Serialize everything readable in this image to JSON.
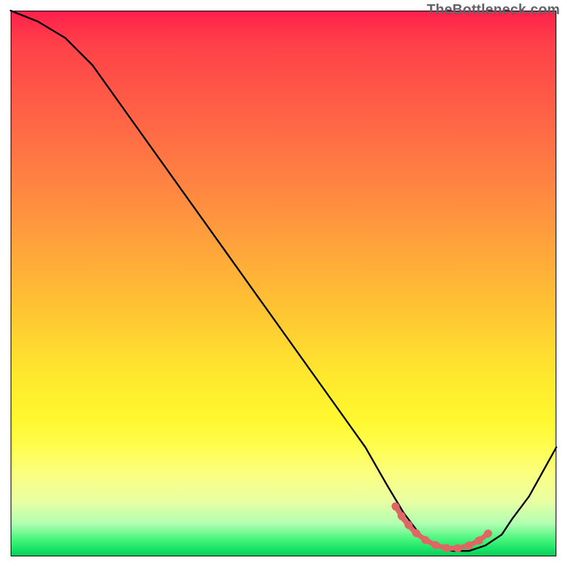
{
  "branding": "TheBottleneck.com",
  "colors": {
    "curve": "#000000",
    "highlight": "#e06666",
    "border": "#000000"
  },
  "chart_data": {
    "type": "line",
    "title": "",
    "xlabel": "",
    "ylabel": "",
    "xlim": [
      0,
      100
    ],
    "ylim": [
      0,
      100
    ],
    "grid": false,
    "note": "Axes are implied (no tick labels in image); values estimated from pixel positions within the 770×770 gradient plot area.",
    "series": [
      {
        "name": "curve",
        "x": [
          0,
          5,
          10,
          15,
          20,
          25,
          30,
          35,
          40,
          45,
          50,
          55,
          60,
          65,
          69,
          72,
          75,
          78,
          81,
          84,
          87,
          90,
          92,
          95,
          100
        ],
        "y": [
          100,
          98,
          95,
          90,
          83,
          76,
          69,
          62,
          55,
          48,
          41,
          34,
          27,
          20,
          13,
          8,
          4,
          2,
          1,
          1,
          2,
          4,
          7,
          11,
          20
        ]
      },
      {
        "name": "highlight-band",
        "x": [
          70.5,
          72,
          74,
          76,
          78,
          80,
          82,
          84,
          86,
          87.5
        ],
        "y": [
          9.2,
          6.8,
          4.5,
          3.0,
          2.0,
          1.5,
          1.5,
          2.0,
          3.0,
          4.2
        ]
      }
    ],
    "background_gradient": {
      "direction": "top-to-bottom",
      "stops": [
        {
          "pos": 0.0,
          "color": "#ff1f4b"
        },
        {
          "pos": 0.06,
          "color": "#ff4049"
        },
        {
          "pos": 0.22,
          "color": "#ff6a45"
        },
        {
          "pos": 0.38,
          "color": "#ff953f"
        },
        {
          "pos": 0.54,
          "color": "#ffc233"
        },
        {
          "pos": 0.67,
          "color": "#ffe82e"
        },
        {
          "pos": 0.75,
          "color": "#fff82f"
        },
        {
          "pos": 0.8,
          "color": "#fffd4f"
        },
        {
          "pos": 0.85,
          "color": "#fbff82"
        },
        {
          "pos": 0.9,
          "color": "#e9ffa3"
        },
        {
          "pos": 0.94,
          "color": "#b0ffb1"
        },
        {
          "pos": 0.97,
          "color": "#44f47a"
        },
        {
          "pos": 0.99,
          "color": "#12df63"
        },
        {
          "pos": 1.0,
          "color": "#09c957"
        }
      ]
    }
  }
}
